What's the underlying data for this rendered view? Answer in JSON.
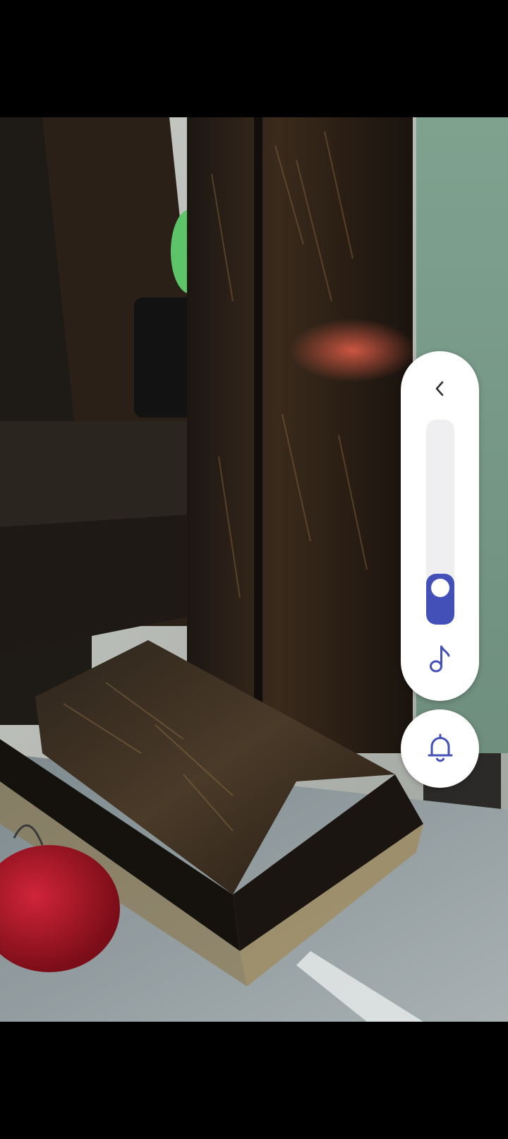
{
  "volume_panel": {
    "level_fraction": 0.24,
    "accent_color": "#4350b8",
    "collapse_icon": "chevron-left-icon",
    "stream_icon": "music-note-icon"
  },
  "ringer_button": {
    "icon": "bell-icon"
  }
}
